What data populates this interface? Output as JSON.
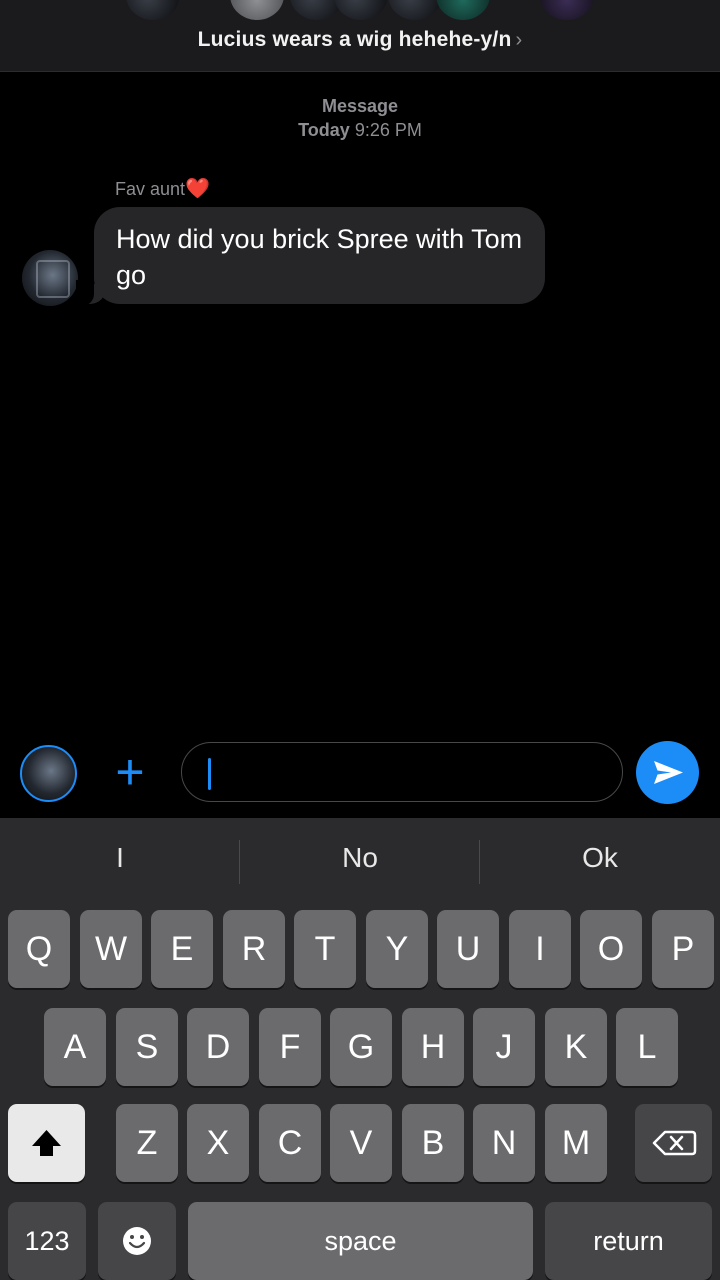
{
  "header": {
    "group_name": "Lucius wears a wig hehehe-y/n",
    "chevron": "›"
  },
  "conversation": {
    "timestamp_label": "Message",
    "timestamp_day": "Today",
    "timestamp_time": "9:26 PM",
    "messages": [
      {
        "sender": "Fav aunt",
        "sender_emoji": "❤️",
        "text": "How did you brick Spree with Tom go"
      }
    ]
  },
  "composer": {
    "input_value": "",
    "plus_icon": "+",
    "send_icon": "send-arrow"
  },
  "keyboard": {
    "predictions": [
      "I",
      "No",
      "Ok"
    ],
    "row1": [
      "Q",
      "W",
      "E",
      "R",
      "T",
      "Y",
      "U",
      "I",
      "O",
      "P"
    ],
    "row2": [
      "A",
      "S",
      "D",
      "F",
      "G",
      "H",
      "J",
      "K",
      "L"
    ],
    "row3": [
      "Z",
      "X",
      "C",
      "V",
      "B",
      "N",
      "M"
    ],
    "numbers_label": "123",
    "space_label": "space",
    "return_label": "return"
  },
  "colors": {
    "accent": "#1c8cf7",
    "bubble": "#262629",
    "keyboard_bg": "#2b2b2d",
    "key": "#6b6b6e",
    "key_dark": "#464649"
  }
}
